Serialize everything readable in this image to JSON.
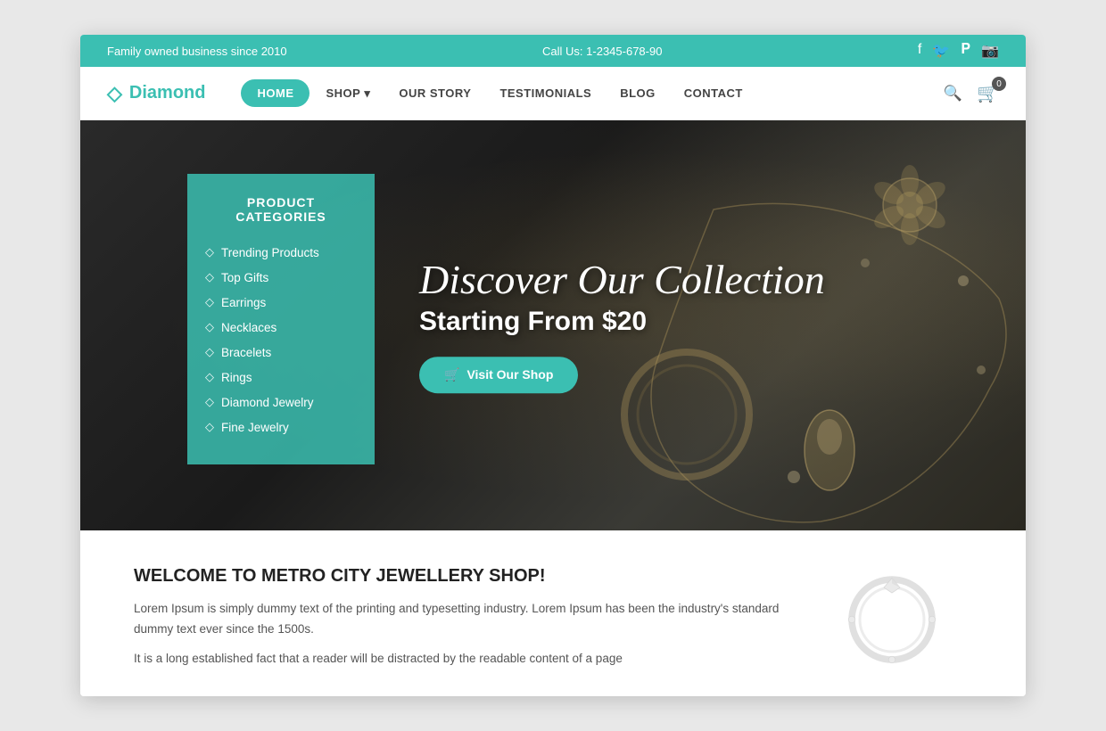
{
  "topbar": {
    "left": "Family owned business since 2010",
    "center": "Call Us: 1-2345-678-90",
    "social": [
      "f",
      "𝕏",
      "𝕡",
      "📷"
    ]
  },
  "logo": {
    "icon": "◇",
    "name": "Diamond"
  },
  "nav": {
    "links": [
      {
        "label": "HOME",
        "active": true,
        "id": "home"
      },
      {
        "label": "SHOP ▾",
        "active": false,
        "id": "shop"
      },
      {
        "label": "OUR STORY",
        "active": false,
        "id": "our-story"
      },
      {
        "label": "TESTIMONIALS",
        "active": false,
        "id": "testimonials"
      },
      {
        "label": "BLOG",
        "active": false,
        "id": "blog"
      },
      {
        "label": "CONTACT",
        "active": false,
        "id": "contact"
      }
    ],
    "cart_count": "0"
  },
  "hero": {
    "categories_title": "PRODUCT CATEGORIES",
    "categories": [
      "Trending Products",
      "Top Gifts",
      "Earrings",
      "Necklaces",
      "Bracelets",
      "Rings",
      "Diamond Jewelry",
      "Fine Jewelry"
    ],
    "discover_text": "Discover Our Collection",
    "starting_text": "Starting From $20",
    "btn_label": "Visit Our Shop"
  },
  "welcome": {
    "title": "WELCOME TO METRO CITY JEWELLERY SHOP!",
    "para1": "Lorem Ipsum is simply dummy text of the printing and typesetting industry. Lorem Ipsum has been the industry's standard dummy text ever since the 1500s.",
    "para2": "It is a long established fact that a reader will be distracted by the readable content of a page"
  }
}
